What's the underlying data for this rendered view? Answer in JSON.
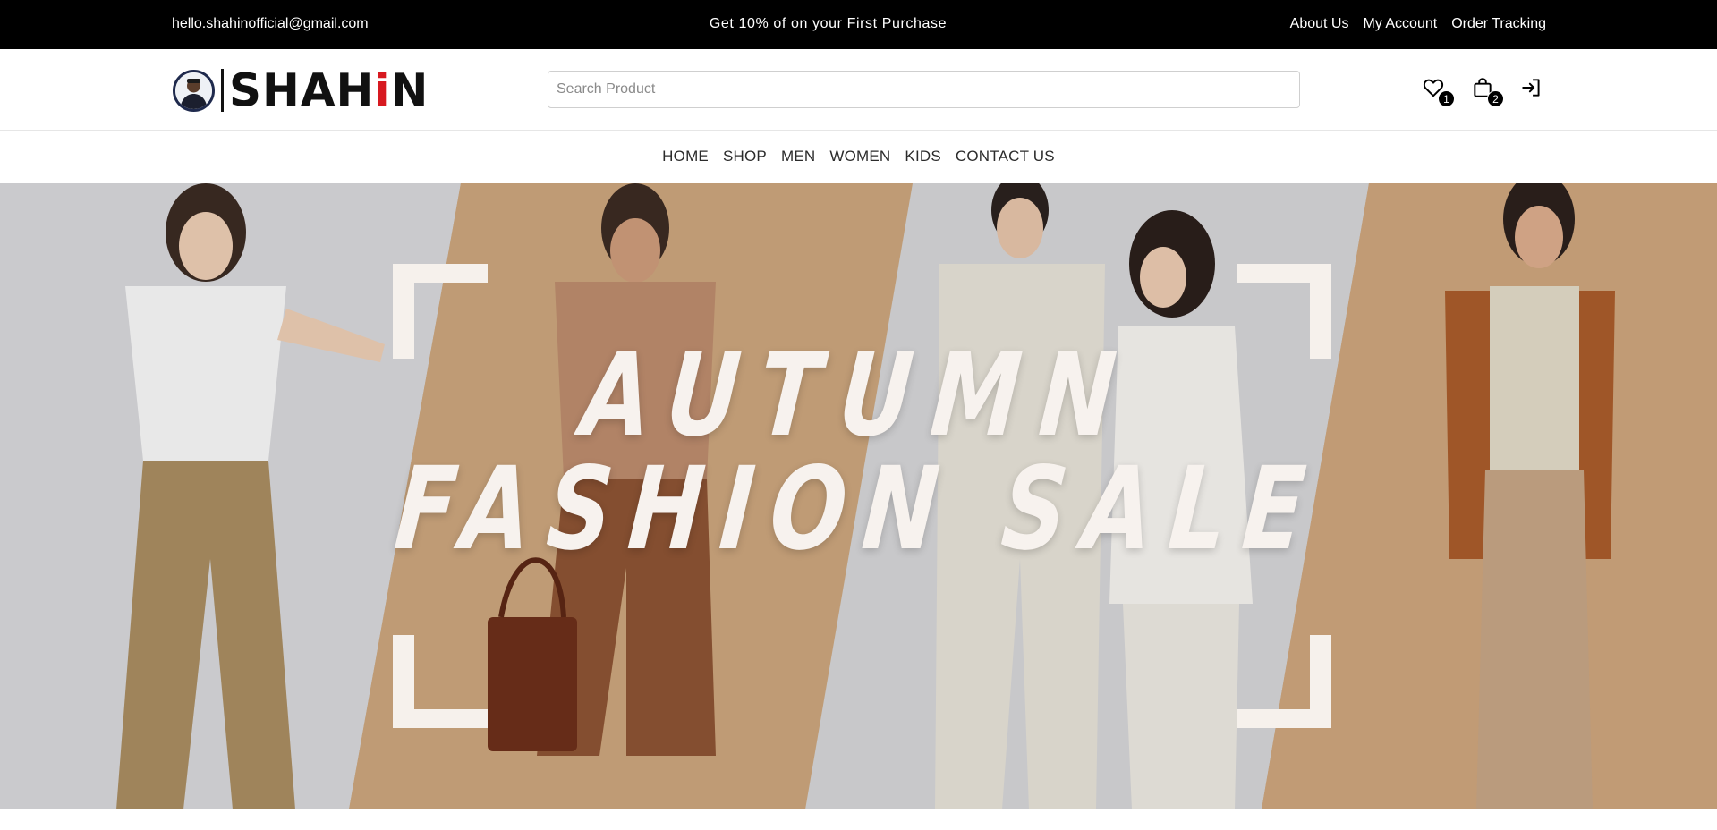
{
  "topbar": {
    "email": "hello.shahinofficial@gmail.com",
    "promo": "Get 10% of on your First Purchase",
    "links": [
      "About Us",
      "My Account",
      "Order Tracking"
    ]
  },
  "header": {
    "logo_text": "SHAHiN",
    "search_placeholder": "Search Product",
    "wishlist_count": "1",
    "cart_count": "2"
  },
  "nav": {
    "items": [
      "HOME",
      "SHOP",
      "MEN",
      "WOMEN",
      "KIDS",
      "CONTACT US"
    ]
  },
  "hero": {
    "line1": "AUTUMN",
    "line2": "FASHION SALE"
  },
  "colors": {
    "topbar": "#000000",
    "accent": "#d71920",
    "hero_tan": "#c8a57a",
    "hero_grey": "#cfcfd1",
    "hero_text": "#f7f2ee"
  }
}
